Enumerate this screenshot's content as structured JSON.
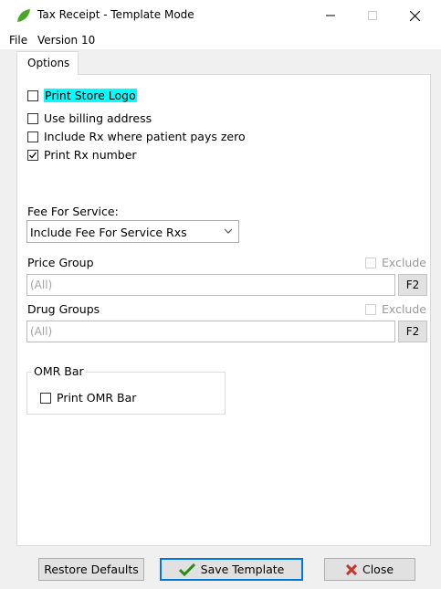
{
  "window": {
    "title": "Tax Receipt - Template Mode",
    "icon": "leaf-icon",
    "accent_color": "#4aa624"
  },
  "menu": [
    "File",
    "Version 10"
  ],
  "tabs": [
    {
      "label": "Options",
      "selected": true
    }
  ],
  "options": {
    "checkboxes": [
      {
        "label": "Print Store Logo",
        "checked": false,
        "focused": true
      },
      {
        "label": "Use billing address",
        "checked": false
      },
      {
        "label": "Include Rx where patient pays zero",
        "checked": false
      },
      {
        "label": "Print Rx number",
        "checked": true
      }
    ],
    "fee_for_service": {
      "label": "Fee For Service:",
      "selected": "Include Fee For Service Rxs"
    },
    "price_group": {
      "label": "Price Group",
      "exclude_label": "Exclude",
      "value": "(All)",
      "lookup_label": "F2"
    },
    "drug_groups": {
      "label": "Drug Groups",
      "exclude_label": "Exclude",
      "value": "(All)",
      "lookup_label": "F2"
    },
    "omr": {
      "group_title": "OMR Bar",
      "checkbox_label": "Print OMR Bar",
      "checked": false
    }
  },
  "buttons": {
    "restore": "Restore Defaults",
    "save": "Save Template",
    "close": "Close"
  },
  "colors": {
    "focus_highlight": "#00ffff",
    "primary_border": "#0078d7",
    "save_check": "#2e8b17",
    "close_x": "#c0392b"
  }
}
